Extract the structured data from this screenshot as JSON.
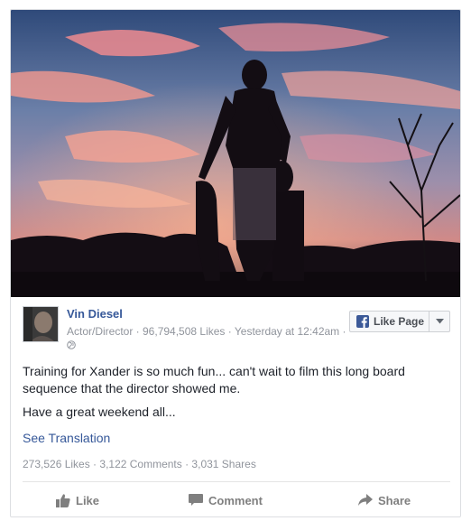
{
  "post": {
    "page_name": "Vin Diesel",
    "meta": "Actor/Director · 96,794,508 Likes · Yesterday at 12:42am ·",
    "like_page_label": "Like Page",
    "text_line1": "Training for Xander is so much fun... can't wait to film this long board sequence that the director showed me.",
    "text_line2": "Have a great weekend all...",
    "see_translation": "See Translation",
    "stats": "273,526 Likes · 3,122 Comments · 3,031 Shares"
  },
  "actions": {
    "like": "Like",
    "comment": "Comment",
    "share": "Share"
  },
  "icons": {
    "facebook": "facebook-icon",
    "globe": "globe-icon",
    "dropdown": "chevron-down-icon",
    "thumbs_up": "thumbs-up-icon",
    "comment": "comment-bubble-icon",
    "share": "share-arrow-icon"
  },
  "colors": {
    "link_blue": "#365899",
    "fb_blue": "#3b5998",
    "meta_gray": "#90949c"
  }
}
